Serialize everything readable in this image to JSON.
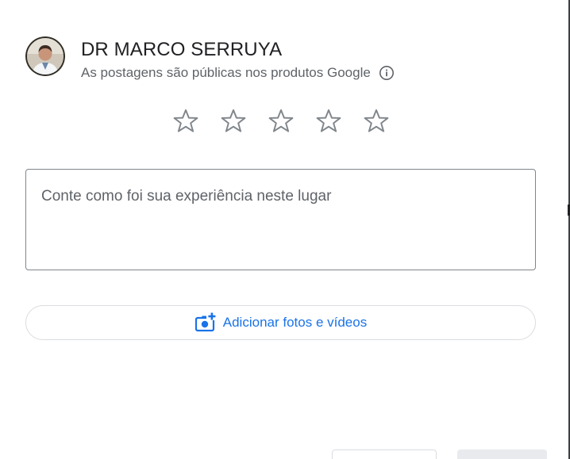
{
  "header": {
    "name": "DR MARCO SERRUYA",
    "subtitle": "As postagens são públicas nos produtos Google",
    "avatar_icon": "profile-photo",
    "info_icon": "info-icon"
  },
  "rating": {
    "max": 5,
    "value": 0,
    "star_icon": "star-outline-icon",
    "star_color": "#80868b"
  },
  "review": {
    "placeholder": "Conte como foi sua experiência neste lugar",
    "value": ""
  },
  "media": {
    "label": "Adicionar fotos e vídeos",
    "icon": "add-photo-icon",
    "accent_color": "#1a73e8"
  }
}
